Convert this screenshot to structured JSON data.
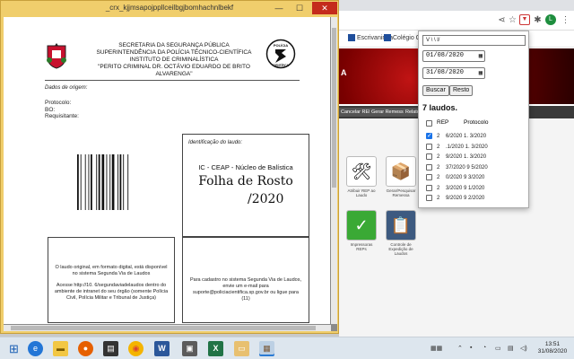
{
  "doc_window": {
    "title": "_crx_kjjmsapojppllceilbgjbomhachnlbekf",
    "controls": {
      "minimize": "—",
      "maximize": "☐",
      "close": "✕"
    }
  },
  "document": {
    "header_lines": [
      "SECRETARIA DA SEGURANÇA PÚBLICA",
      "SUPERINTENDÊNCIA DA POLÍCIA TÉCNICO-CIENTÍFICA",
      "INSTITUTO DE CRIMINALÍSTICA",
      "\"PERITO CRIMINAL DR. OCTÁVIO EDUARDO DE BRITO ALVARENGA\""
    ],
    "logo_text_top": "POLÍCIA",
    "logo_text_bottom": "CIENTÍFICA",
    "origin_label": "Dados de origem:",
    "protocol_label": "Protocolo:",
    "bo_label": "BO:",
    "requester_label": "Requisitante:",
    "ident_label": "Identificação do laudo:",
    "ident_sub": "IC - CEAP - Núcleo de Balística",
    "folha_title": "Folha de Rosto",
    "year": "/2020",
    "left_box_text": "O laudo original, em formato digital, está disponível no sistema Segunda Via de Laudos",
    "left_box_text2": "Acesse http://10.         6/segundaviadelaudos dentro do ambiente de intranet do seu órgão (somente Polícia Civil, Polícia Militar e Tribunal de Justiça)",
    "right_box_text": "Para cadastro no sistema Segunda Via de Laudos, envie um e-mail para suporte@policiacientifica.sp.gov.br ou ligue para (11)"
  },
  "browser": {
    "bookmarks": [
      {
        "label": "Escrivaninha"
      },
      {
        "label": "Colégio Ol"
      }
    ],
    "avatar_letter": "L",
    "banner_text": "A",
    "menu_items": [
      "Cancelar REP",
      "Gerar Remessa",
      "Relato"
    ],
    "tiles": [
      {
        "caption": "Atribuir REP ao Laudo"
      },
      {
        "caption": "Gerar/Pesquisar Remessa"
      },
      {
        "caption": "Impressoras REPs"
      },
      {
        "caption": "Controle de Expedição de Laudos"
      }
    ]
  },
  "popup": {
    "select_value": "V          \\  \\    l/",
    "date_start": "01/08/2020",
    "date_end": "31/08/2020",
    "search_button": "Buscar",
    "clear_button": "Resto",
    "count_label": "7 laudos.",
    "col_rep": "REP",
    "col_protocol": "Protocolo",
    "rows": [
      {
        "rep": "2",
        "protocol": "6/2020  1.     3/2020",
        "checked": true
      },
      {
        "rep": "2",
        "protocol": ".1/2020  1.     3/2020",
        "checked": false
      },
      {
        "rep": "2",
        "protocol": "9/2020  1.     3/2020",
        "checked": false
      },
      {
        "rep": "2",
        "protocol": "37/2020  9   5/2020",
        "checked": false
      },
      {
        "rep": "2",
        "protocol": "0/2020  9   3/2020",
        "checked": false
      },
      {
        "rep": "2",
        "protocol": "3/2020  9   1/2020",
        "checked": false
      },
      {
        "rep": "2",
        "protocol": "9/2020  9   2/2020",
        "checked": false
      }
    ]
  },
  "taskbar": {
    "clock_time": "13:51",
    "clock_date": "31/08/2020",
    "word_letter": "W",
    "excel_letter": "X"
  },
  "colors": {
    "doc_frame": "#f0ce6c",
    "banner_red": "#c01414",
    "close_red": "#c42b1c",
    "checkbox_blue": "#1a73e8"
  }
}
